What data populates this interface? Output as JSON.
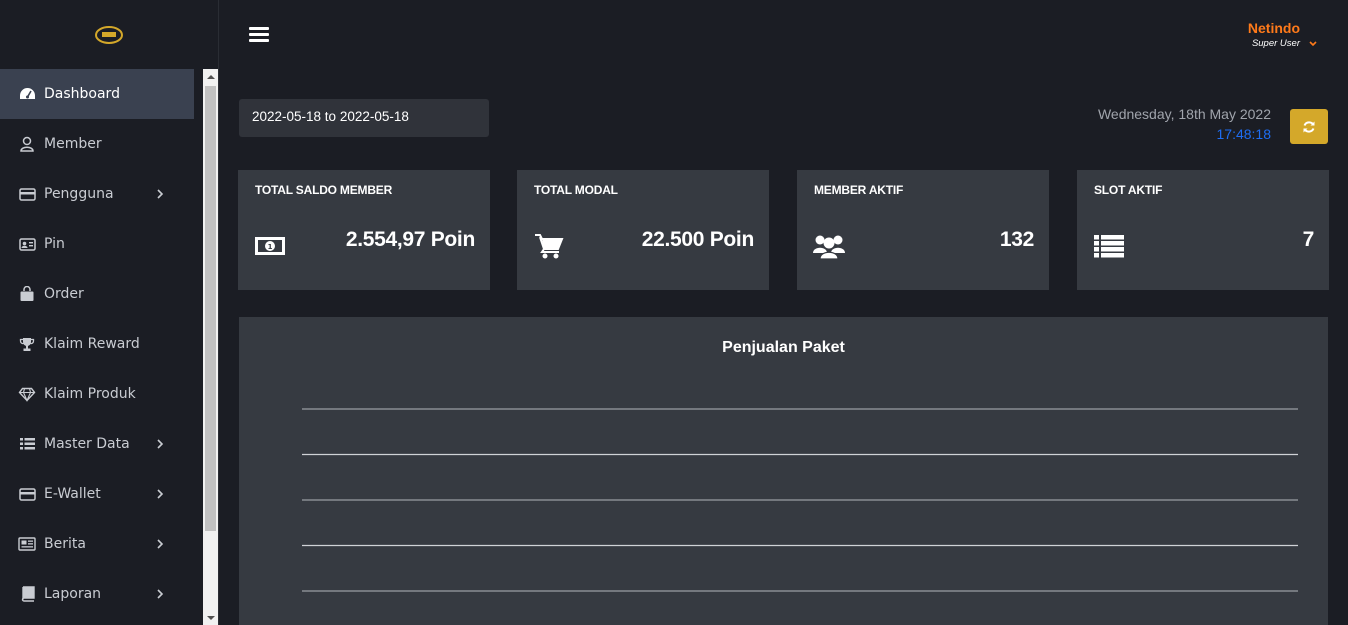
{
  "header": {
    "user_name": "Netindo",
    "user_role": "Super User"
  },
  "sidebar": {
    "items": [
      {
        "label": "Dashboard",
        "icon": "dashboard-icon",
        "active": true,
        "has_submenu": false
      },
      {
        "label": "Member",
        "icon": "user-icon",
        "active": false,
        "has_submenu": false
      },
      {
        "label": "Pengguna",
        "icon": "credit-card-icon",
        "active": false,
        "has_submenu": true
      },
      {
        "label": "Pin",
        "icon": "id-card-icon",
        "active": false,
        "has_submenu": false
      },
      {
        "label": "Order",
        "icon": "shopping-bag-icon",
        "active": false,
        "has_submenu": false
      },
      {
        "label": "Klaim Reward",
        "icon": "trophy-icon",
        "active": false,
        "has_submenu": false
      },
      {
        "label": "Klaim Produk",
        "icon": "diamond-icon",
        "active": false,
        "has_submenu": false
      },
      {
        "label": "Master Data",
        "icon": "list-icon",
        "active": false,
        "has_submenu": true
      },
      {
        "label": "E-Wallet",
        "icon": "credit-card-icon",
        "active": false,
        "has_submenu": true
      },
      {
        "label": "Berita",
        "icon": "newspaper-icon",
        "active": false,
        "has_submenu": true
      },
      {
        "label": "Laporan",
        "icon": "book-icon",
        "active": false,
        "has_submenu": true
      }
    ]
  },
  "filters": {
    "date_range": "2022-05-18 to 2022-05-18"
  },
  "datetime": {
    "date": "Wednesday, 18th May 2022",
    "time": "17:48:18"
  },
  "stats": [
    {
      "title": "TOTAL SALDO MEMBER",
      "value": "2.554,97 Poin",
      "icon": "money-icon"
    },
    {
      "title": "TOTAL MODAL",
      "value": "22.500 Poin",
      "icon": "cart-icon"
    },
    {
      "title": "MEMBER AKTIF",
      "value": "132",
      "icon": "users-icon"
    },
    {
      "title": "SLOT AKTIF",
      "value": "7",
      "icon": "list-icon"
    }
  ],
  "chart_data": {
    "type": "line",
    "title": "Penjualan Paket",
    "series": [],
    "grid": true,
    "gridline_count": 5
  },
  "colors": {
    "accent_orange": "#ff7a1a",
    "refresh_button": "#d4a82a",
    "time_blue": "#1e6df2",
    "card_bg": "#363a41",
    "page_bg": "#1b1d24"
  }
}
